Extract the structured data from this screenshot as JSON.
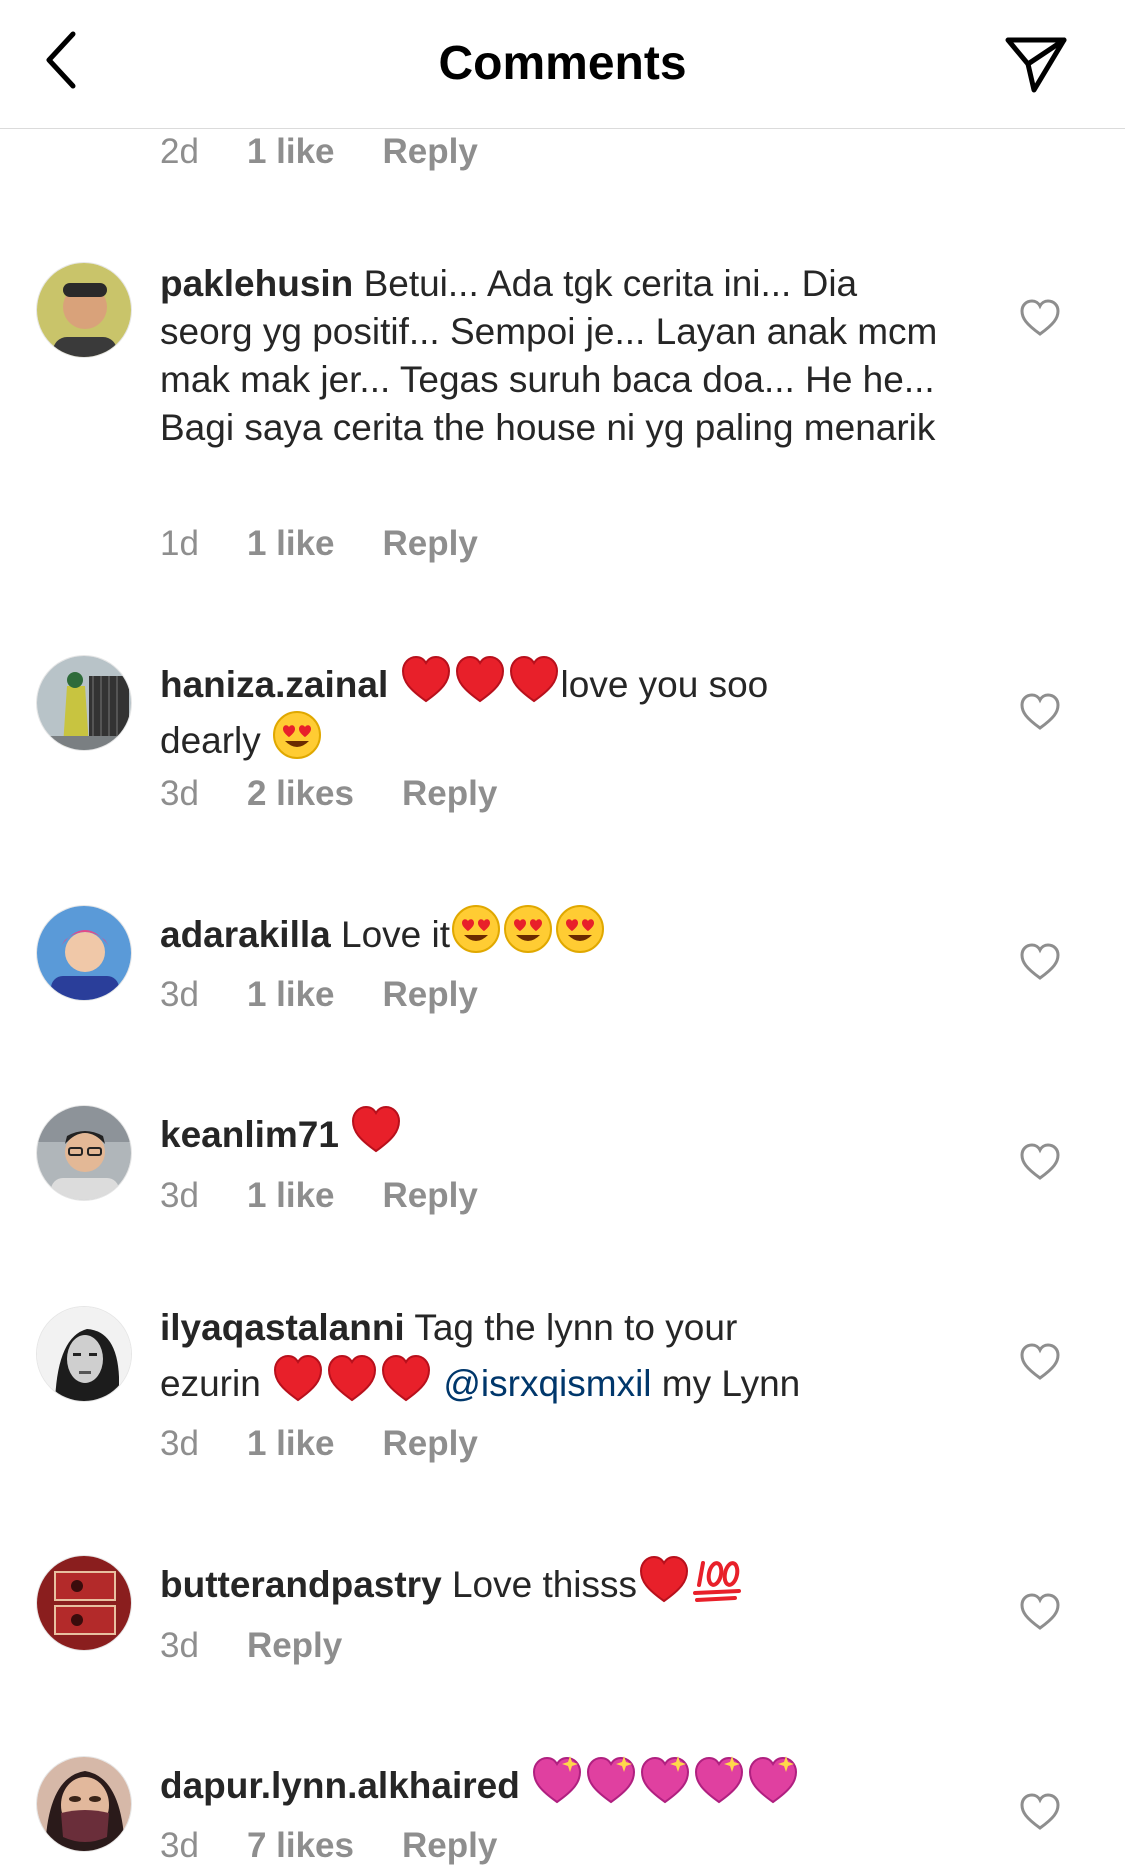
{
  "header": {
    "title": "Comments",
    "back_icon": "chevron-left-icon",
    "share_icon": "paper-plane-icon"
  },
  "top_meta": {
    "time": "2d",
    "likes": "1 like",
    "reply": "Reply"
  },
  "comments": [
    {
      "username": "paklehusin",
      "text": "Betui... Ada tgk cerita ini... Dia seorg yg positif... Sempoi je... Layan anak mcm mak mak jer... Tegas suruh baca doa... He he... Bagi saya cerita the house ni yg paling menarik",
      "time": "1d",
      "likes": "1 like",
      "reply": "Reply"
    },
    {
      "username": "haniza.zainal",
      "text_after": "love you soo",
      "text_line2": "dearly",
      "time": "3d",
      "likes": "2 likes",
      "reply": "Reply"
    },
    {
      "username": "adarakilla",
      "text": "Love it",
      "time": "3d",
      "likes": "1 like",
      "reply": "Reply"
    },
    {
      "username": "keanlim71",
      "time": "3d",
      "likes": "1 like",
      "reply": "Reply"
    },
    {
      "username": "ilyaqastalanni",
      "text": "Tag the lynn to your",
      "text_line2": "ezurin",
      "mention": "@isrxqismxil",
      "text_after": "my Lynn",
      "time": "3d",
      "likes": "1 like",
      "reply": "Reply"
    },
    {
      "username": "butterandpastry",
      "text": "Love thisss",
      "time": "3d",
      "reply": "Reply"
    },
    {
      "username": "dapur.lynn.alkhaired",
      "time": "3d",
      "likes": "7 likes",
      "reply": "Reply"
    }
  ],
  "colors": {
    "meta_gray": "#8e8e8e",
    "text": "#262626",
    "mention": "#00376b",
    "heart_red": "#e8202a",
    "sparkle_heart": "#e040a0"
  }
}
